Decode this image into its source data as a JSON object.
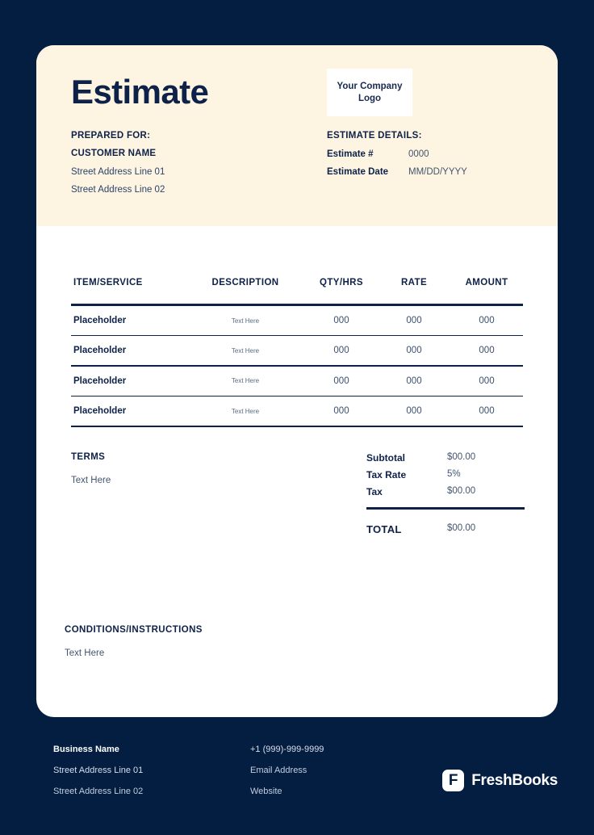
{
  "document": {
    "title": "Estimate",
    "logo_placeholder": "Your Company Logo",
    "prepared_for": {
      "label": "PREPARED FOR:",
      "customer_name": "CUSTOMER NAME",
      "address_line_1": "Street Address Line 01",
      "address_line_2": "Street Address Line 02"
    },
    "estimate_details": {
      "label": "ESTIMATE DETAILS:",
      "rows": [
        {
          "key": "Estimate #",
          "value": "0000"
        },
        {
          "key": "Estimate Date",
          "value": "MM/DD/YYYY"
        }
      ]
    },
    "table": {
      "headers": [
        "ITEM/SERVICE",
        "DESCRIPTION",
        "QTY/HRS",
        "RATE",
        "AMOUNT"
      ],
      "rows": [
        {
          "item": "Placeholder",
          "description": "Text Here",
          "qty": "000",
          "rate": "000",
          "amount": "000"
        },
        {
          "item": "Placeholder",
          "description": "Text Here",
          "qty": "000",
          "rate": "000",
          "amount": "000"
        },
        {
          "item": "Placeholder",
          "description": "Text Here",
          "qty": "000",
          "rate": "000",
          "amount": "000"
        },
        {
          "item": "Placeholder",
          "description": "Text Here",
          "qty": "000",
          "rate": "000",
          "amount": "000"
        }
      ]
    },
    "terms": {
      "heading": "TERMS",
      "body": "Text Here"
    },
    "totals": {
      "rows": [
        {
          "key": "Subtotal",
          "value": "$00.00"
        },
        {
          "key": "Tax Rate",
          "value": "5%"
        },
        {
          "key": "Tax",
          "value": "$00.00"
        }
      ],
      "grand_total": {
        "key": "TOTAL",
        "value": "$00.00"
      }
    },
    "conditions": {
      "heading": "CONDITIONS/INSTRUCTIONS",
      "body": "Text Here"
    }
  },
  "footer": {
    "business_name": "Business Name",
    "address_line_1": "Street Address Line 01",
    "address_line_2": "Street Address Line 02",
    "phone": "+1 (999)-999-9999",
    "email": "Email Address",
    "website": "Website",
    "brand": {
      "name": "FreshBooks",
      "mark_letter": "F"
    }
  },
  "colors": {
    "page_background": "#041e42",
    "card_background": "#ffffff",
    "cream_band": "#fdf5e2",
    "ink": "#0d2149",
    "muted_ink": "#43556f"
  }
}
